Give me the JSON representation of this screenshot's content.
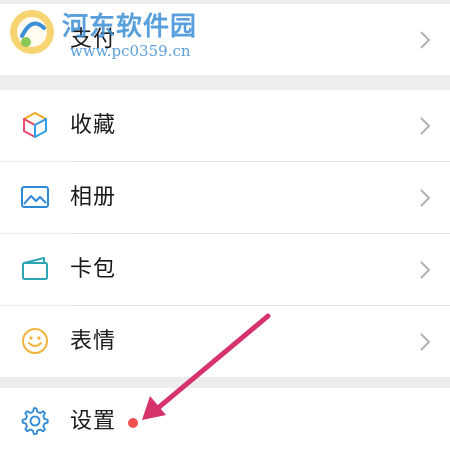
{
  "watermark": {
    "title": "河东软件园",
    "url": "www.pc0359.cn"
  },
  "menu": {
    "pay": {
      "label": "支付",
      "icon": "pay-icon"
    },
    "favorites": {
      "label": "收藏",
      "icon": "cube-icon"
    },
    "album": {
      "label": "相册",
      "icon": "image-icon"
    },
    "cards": {
      "label": "卡包",
      "icon": "card-wallet-icon"
    },
    "stickers": {
      "label": "表情",
      "icon": "smiley-icon"
    },
    "settings": {
      "label": "设置",
      "icon": "gear-icon"
    }
  },
  "colors": {
    "background": "#ededed",
    "notification_dot": "#f0504e",
    "annotation_arrow": "#d6336c",
    "chevron": "#b2b2b2",
    "watermark": "#3b8fd6"
  }
}
